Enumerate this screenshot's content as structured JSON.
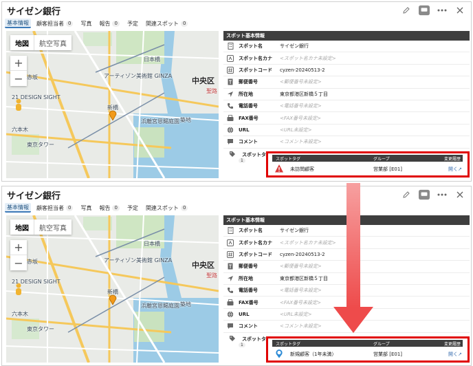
{
  "panels": [
    {
      "title": "サイゼン銀行",
      "tabs": [
        {
          "label": "基本情報",
          "count": null,
          "active": true
        },
        {
          "label": "顧客担当者",
          "count": "0"
        },
        {
          "label": "写真",
          "count": null
        },
        {
          "label": "報告",
          "count": "0"
        },
        {
          "label": "予定",
          "count": null
        },
        {
          "label": "関連スポット",
          "count": "0"
        }
      ],
      "tag": {
        "name": "未訪問顧客",
        "group": "営業部 [E01]",
        "link": "開く↗",
        "icon": "warning-triangle-icon"
      }
    },
    {
      "title": "サイゼン銀行",
      "tabs": [
        {
          "label": "基本情報",
          "count": null,
          "active": true
        },
        {
          "label": "顧客担当者",
          "count": "0"
        },
        {
          "label": "写真",
          "count": null
        },
        {
          "label": "報告",
          "count": "0"
        },
        {
          "label": "予定",
          "count": null
        },
        {
          "label": "関連スポット",
          "count": "0"
        }
      ],
      "tag": {
        "name": "新規顧客（1年未満）",
        "group": "営業部 [E01]",
        "link": "開く↗",
        "icon": "new-customer-pin-icon"
      }
    }
  ],
  "map": {
    "type_map": "地図",
    "type_aerial": "航空写真",
    "zoom_in": "+",
    "zoom_out": "−",
    "labels": {
      "chuo": "中央区",
      "ginza": "アーティゾン美術館 GINZA",
      "design": "21 DESIGN SIGHT",
      "tokyo_tower": "東京タワー",
      "tsukiji": "築地",
      "hamarikyu": "浜離宮恩賜庭園",
      "shinbashi": "新橋",
      "akasaka": "赤坂",
      "nihonbashi": "日本橋",
      "roppongi": "六本木",
      "seiroka": "聖路"
    }
  },
  "info": {
    "section_title": "スポット基本情報",
    "rows": [
      {
        "label": "スポット名",
        "value": "サイゼン銀行",
        "placeholder": false,
        "icon": "building-icon"
      },
      {
        "label": "スポット名カナ",
        "value": "<スポット名カナ未設定>",
        "placeholder": true,
        "icon": "kana-icon"
      },
      {
        "label": "スポットコード",
        "value": "cyzen-20240513-2",
        "placeholder": false,
        "icon": "hash-icon"
      },
      {
        "label": "郵便番号",
        "value": "<郵便番号未設定>",
        "placeholder": true,
        "icon": "postal-icon"
      },
      {
        "label": "所在地",
        "value": "東京都港区新橋５丁目",
        "placeholder": false,
        "icon": "location-arrow-icon"
      },
      {
        "label": "電話番号",
        "value": "<電話番号未設定>",
        "placeholder": true,
        "icon": "phone-icon"
      },
      {
        "label": "FAX番号",
        "value": "<FAX番号未設定>",
        "placeholder": true,
        "icon": "fax-icon"
      },
      {
        "label": "URL",
        "value": "<URL未設定>",
        "placeholder": true,
        "icon": "globe-icon"
      },
      {
        "label": "コメント",
        "value": "<コメント未設定>",
        "placeholder": true,
        "icon": "comment-icon"
      }
    ],
    "tag_label": "スポットタグ",
    "tag_count": "1",
    "tag_headers": {
      "tag": "スポットタグ",
      "group": "グループ",
      "history": "変更履歴"
    }
  },
  "colors": {
    "highlight": "#e00000",
    "arrow": "#f05050",
    "header": "#3e3e3e",
    "link": "#3a6fb0"
  }
}
